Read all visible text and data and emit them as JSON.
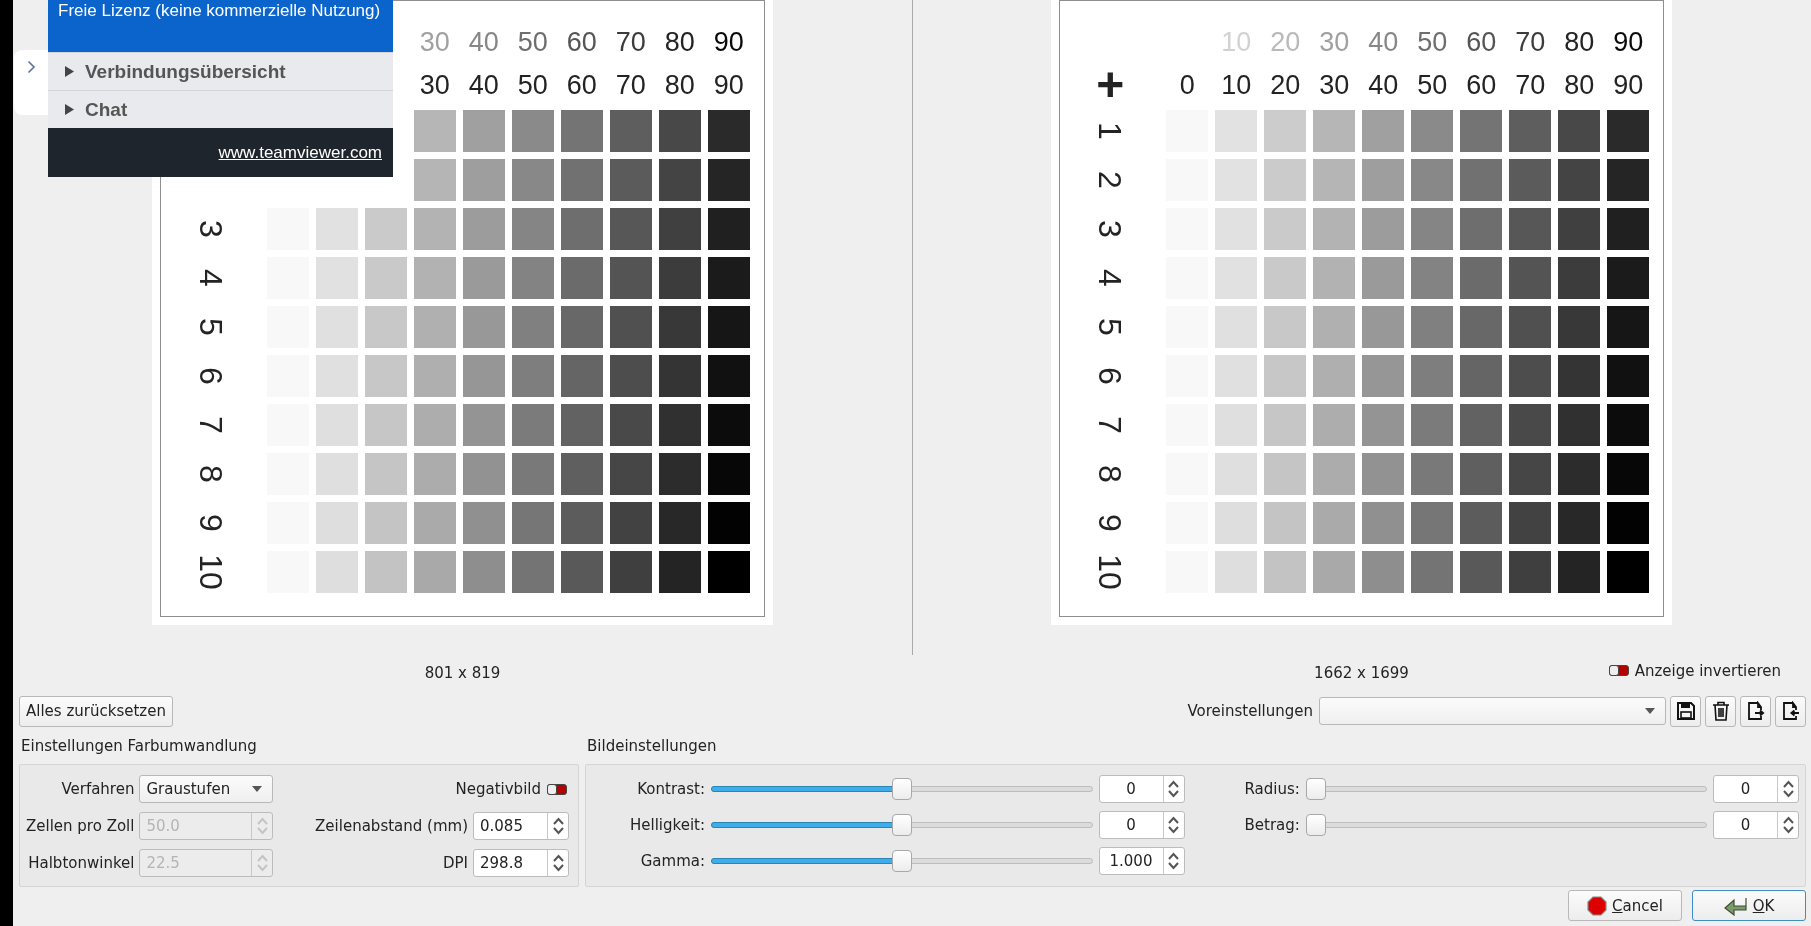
{
  "popup": {
    "license": "Freie Lizenz (keine kommerzielle Nutzung)",
    "items": [
      {
        "label": "Verbindungsübersicht",
        "expanded": false
      },
      {
        "label": "Chat",
        "expanded": false
      }
    ],
    "link": "www.teamviewer.com"
  },
  "previews": [
    {
      "top_labels": [
        "30",
        "40",
        "50",
        "60",
        "70",
        "80",
        "90"
      ],
      "bottom_labels": [
        "30",
        "40",
        "50",
        "60",
        "70",
        "80",
        "90"
      ],
      "row_labels": [
        "3",
        "4",
        "5",
        "6",
        "7",
        "8",
        "9",
        "10"
      ],
      "dimensions": "801 x 819"
    },
    {
      "marker": "+",
      "top_labels": [
        "10",
        "20",
        "30",
        "40",
        "50",
        "60",
        "70",
        "80",
        "90"
      ],
      "bottom_labels": [
        "0",
        "10",
        "20",
        "30",
        "40",
        "50",
        "60",
        "70",
        "80",
        "90"
      ],
      "row_labels": [
        "1",
        "2",
        "3",
        "4",
        "5",
        "6",
        "7",
        "8",
        "9",
        "10"
      ],
      "dimensions": "1662 x 1699"
    }
  ],
  "invert_display": {
    "label": "Anzeige invertieren",
    "checked": false
  },
  "reset_button": "Alles zurücksetzen",
  "presets": {
    "label": "Voreinstellungen",
    "actions": [
      {
        "kind": "save"
      },
      {
        "kind": "delete"
      },
      {
        "kind": "export"
      },
      {
        "kind": "import"
      }
    ]
  },
  "color_conversion": {
    "title": "Einstellungen Farbumwandlung",
    "method": {
      "label": "Verfahren",
      "value": "Graustufen"
    },
    "negative": {
      "label": "Negativbild",
      "checked": false
    },
    "fields": [
      {
        "label": "Zellen pro Zoll",
        "value": "50.0",
        "disabled": true
      },
      {
        "label": "Zeilenabstand (mm)",
        "value": "0.085",
        "disabled": false
      },
      {
        "label": "Halbtonwinkel",
        "value": "22.5",
        "disabled": true
      },
      {
        "label": "DPI",
        "value": "298.8",
        "disabled": false
      }
    ]
  },
  "image_settings": {
    "title": "Bildeinstellungen",
    "columns": [
      [
        {
          "label": "Kontrast:",
          "level": 0.5,
          "value": "0"
        },
        {
          "label": "Helligkeit:",
          "level": 0.5,
          "value": "0"
        },
        {
          "label": "Gamma:",
          "level": 0.5,
          "value": "1.000"
        }
      ],
      [
        {
          "label": "Radius:",
          "level": 0,
          "value": "0"
        },
        {
          "label": "Betrag:",
          "level": 0,
          "value": "0"
        }
      ]
    ]
  },
  "buttons": [
    {
      "label": "Cancel",
      "kind": "cancel"
    },
    {
      "label": "OK",
      "kind": "ok"
    }
  ]
}
